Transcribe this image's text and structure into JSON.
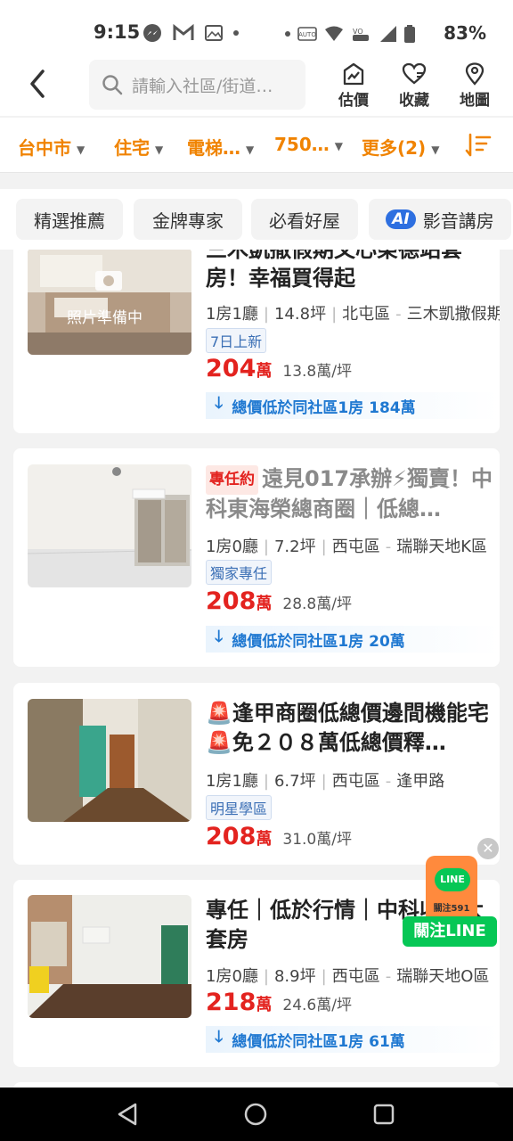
{
  "status": {
    "time": "9:15",
    "battery": "83%"
  },
  "header": {
    "search_placeholder": "請輸入社區/街道…",
    "actions": [
      {
        "label": "估價",
        "icon": "valuation-chart-icon"
      },
      {
        "label": "收藏",
        "icon": "heart-icon"
      },
      {
        "label": "地圖",
        "icon": "map-pin-icon"
      }
    ]
  },
  "filters": {
    "city": "台中市",
    "type": "住宅",
    "building": "電梯…",
    "price": "750…",
    "more": "更多(2)"
  },
  "tabs": [
    {
      "label": "精選推薦"
    },
    {
      "label": "金牌專家"
    },
    {
      "label": "必看好屋"
    },
    {
      "label": "影音講房",
      "badge": "AI"
    }
  ],
  "listings": [
    {
      "title_partial": "三木凱撒假期文心榮德站套",
      "title": "房！幸福買得起",
      "photo_text": "照片準備中",
      "rooms": "1房1廳",
      "size": "14.8坪",
      "district": "北屯區",
      "community": "三木凱撒假期",
      "tag": "7日上新",
      "price": "204",
      "price_unit": "萬",
      "per_ping": "13.8萬/坪",
      "banner": "總價低於同社區1房 184萬"
    },
    {
      "badge": "專任約",
      "title": "遠見017承辦⚡獨賣！中科東海榮總商圈｜低總…",
      "rooms": "1房0廳",
      "size": "7.2坪",
      "district": "西屯區",
      "community": "瑞聯天地K區",
      "tag": "獨家專任",
      "price": "208",
      "price_unit": "萬",
      "per_ping": "28.8萬/坪",
      "banner": "總價低於同社區1房 20萬"
    },
    {
      "title": "🚨逢甲商圈低總價邊間機能宅🚨免２０８萬低總價釋…",
      "rooms": "1房1廳",
      "size": "6.7坪",
      "district": "西屯區",
      "community": "逢甲路",
      "tag": "明星學區",
      "price": "208",
      "price_unit": "萬",
      "per_ping": "31.0萬/坪"
    },
    {
      "title": "專任｜低於行情｜中科收租大套房",
      "rooms": "1房0廳",
      "size": "8.9坪",
      "district": "西屯區",
      "community": "瑞聯天地O區",
      "price": "218",
      "price_unit": "萬",
      "per_ping": "24.6萬/坪",
      "banner": "總價低於同社區1房 61萬"
    }
  ],
  "line_float": {
    "bubble": "LINE",
    "sub": "關注591",
    "button": "關注LINE",
    "close": "✕"
  },
  "colors": {
    "accent": "#f08300",
    "price": "#e3231f",
    "link": "#1f78d1",
    "line_green": "#06c755"
  }
}
